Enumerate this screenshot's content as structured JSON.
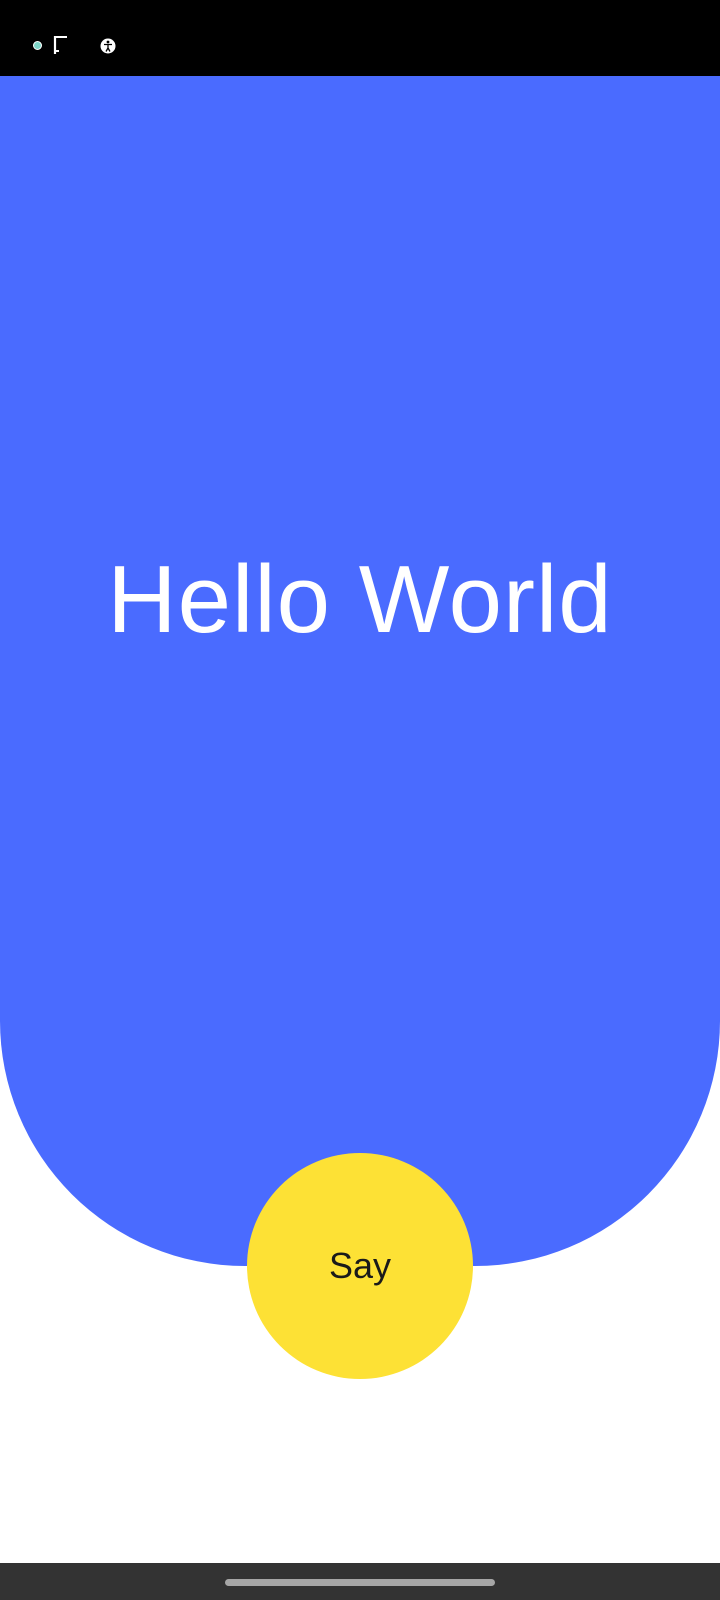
{
  "status_bar": {
    "icons": [
      "notification-dot-icon",
      "flag-icon",
      "accessibility-icon"
    ],
    "background": "#000000"
  },
  "hero": {
    "title": "Hello World",
    "background": "#4a6bff",
    "text_color": "#ffffff"
  },
  "action": {
    "say_label": "Say",
    "background": "#fde135"
  },
  "nav_bar": {
    "background": "#333333",
    "handle": "home-handle"
  }
}
